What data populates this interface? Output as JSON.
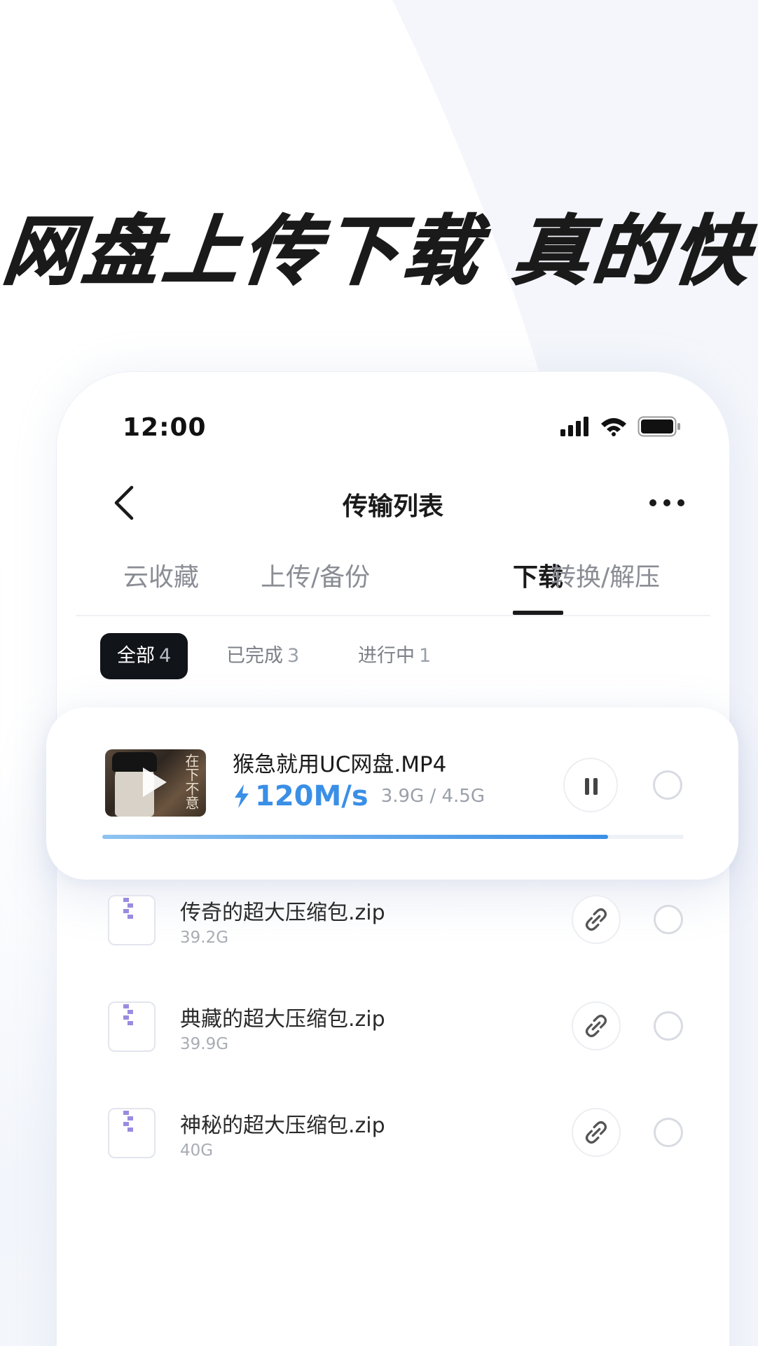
{
  "headline": "网盘上传下载 真的快",
  "status_bar": {
    "time": "12:00",
    "icons": [
      "signal-icon",
      "wifi-icon",
      "battery-icon"
    ]
  },
  "nav": {
    "title": "传输列表",
    "back_icon": "back-chevron-icon",
    "more_icon": "more-dots-icon"
  },
  "tabs": [
    {
      "label": "云收藏",
      "active": false
    },
    {
      "label": "上传/备份",
      "active": false
    },
    {
      "label": "下载",
      "active": true
    },
    {
      "label": "转换/解压",
      "active": false
    }
  ],
  "filters": [
    {
      "label": "全部",
      "count": "4",
      "active": true
    },
    {
      "label": "已完成",
      "count": "3",
      "active": false
    },
    {
      "label": "进行中",
      "count": "1",
      "active": false
    }
  ],
  "active_download": {
    "name": "猴急就用UC网盘.MP4",
    "speed": "120M/s",
    "size_progress": "3.9G / 4.5G",
    "progress": 0.87,
    "thumbnail_text": "在下不意",
    "speed_icon": "lightning-icon",
    "pause_icon": "pause-icon"
  },
  "files": [
    {
      "name": "传奇的超大压缩包.zip",
      "size": "39.2G"
    },
    {
      "name": "典藏的超大压缩包.zip",
      "size": "39.9G"
    },
    {
      "name": "神秘的超大压缩包.zip",
      "size": "40G"
    }
  ],
  "colors": {
    "accent": "#3a8fe6",
    "active_chip": "#111419",
    "zip_icon": "#9b8be0"
  }
}
